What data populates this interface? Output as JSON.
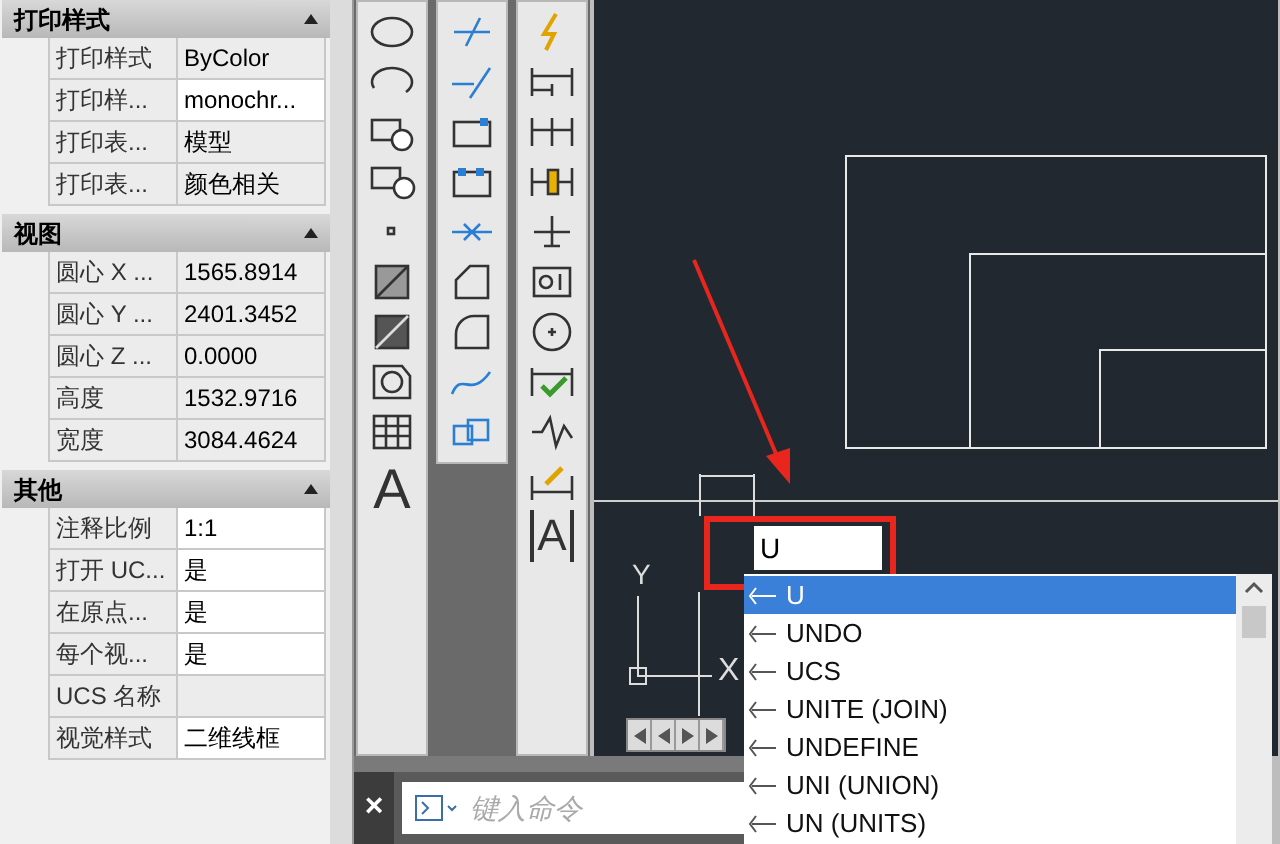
{
  "properties": {
    "sections": [
      {
        "title": "打印样式",
        "expanded": true,
        "rows": [
          {
            "label": "打印样式",
            "value": "ByColor",
            "editable": false
          },
          {
            "label": "打印样...",
            "value": "monochr...",
            "editable": true
          },
          {
            "label": "打印表...",
            "value": "模型",
            "editable": false
          },
          {
            "label": "打印表...",
            "value": "颜色相关",
            "editable": false
          }
        ]
      },
      {
        "title": "视图",
        "expanded": true,
        "rows": [
          {
            "label": "圆心 X ...",
            "value": "1565.8914",
            "editable": false
          },
          {
            "label": "圆心 Y ...",
            "value": "2401.3452",
            "editable": false
          },
          {
            "label": "圆心 Z ...",
            "value": "0.0000",
            "editable": false
          },
          {
            "label": "高度",
            "value": "1532.9716",
            "editable": false
          },
          {
            "label": "宽度",
            "value": "3084.4624",
            "editable": false
          }
        ]
      },
      {
        "title": "其他",
        "expanded": true,
        "rows": [
          {
            "label": "注释比例",
            "value": "1:1",
            "editable": true
          },
          {
            "label": "打开 UC...",
            "value": "是",
            "editable": true
          },
          {
            "label": "在原点...",
            "value": "是",
            "editable": true
          },
          {
            "label": "每个视...",
            "value": "是",
            "editable": true
          },
          {
            "label": "UCS 名称",
            "value": "",
            "editable": false
          },
          {
            "label": "视觉样式",
            "value": "二维线框",
            "editable": true
          }
        ]
      }
    ]
  },
  "toolbar_glyphs": {
    "draw": "A",
    "dimension": "A"
  },
  "canvas": {
    "axis_labels": {
      "y": "Y",
      "x": "X"
    },
    "command_input": {
      "value": "U"
    },
    "suggestions": [
      {
        "label": "U",
        "selected": true
      },
      {
        "label": "UNDO",
        "selected": false
      },
      {
        "label": "UCS",
        "selected": false
      },
      {
        "label": "UNITE (JOIN)",
        "selected": false
      },
      {
        "label": "UNDEFINE",
        "selected": false
      },
      {
        "label": "UNI (UNION)",
        "selected": false
      },
      {
        "label": "UN (UNITS)",
        "selected": false
      }
    ]
  },
  "command_line": {
    "close": "×",
    "placeholder": "键入命令"
  }
}
